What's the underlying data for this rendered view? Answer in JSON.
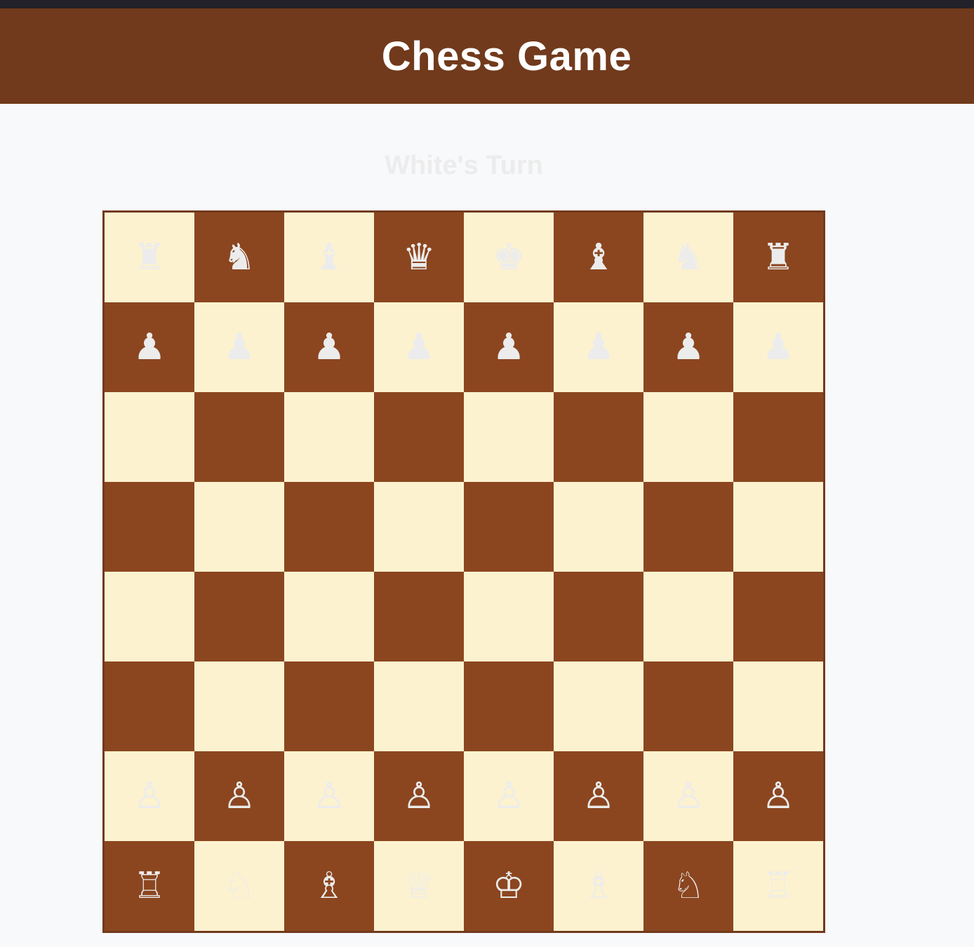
{
  "header": {
    "title": "Chess Game"
  },
  "status": {
    "turn_text": "White's Turn"
  },
  "colors": {
    "header_bg": "#713a1c",
    "light_square": "#fdf2cf",
    "dark_square": "#8b4620",
    "piece": "#ececec"
  },
  "board": {
    "rows": [
      [
        {
          "square": "a8",
          "piece": "♜",
          "piece_name": "black-rook"
        },
        {
          "square": "b8",
          "piece": "♞",
          "piece_name": "black-knight"
        },
        {
          "square": "c8",
          "piece": "♝",
          "piece_name": "black-bishop"
        },
        {
          "square": "d8",
          "piece": "♛",
          "piece_name": "black-queen"
        },
        {
          "square": "e8",
          "piece": "♚",
          "piece_name": "black-king"
        },
        {
          "square": "f8",
          "piece": "♝",
          "piece_name": "black-bishop"
        },
        {
          "square": "g8",
          "piece": "♞",
          "piece_name": "black-knight"
        },
        {
          "square": "h8",
          "piece": "♜",
          "piece_name": "black-rook"
        }
      ],
      [
        {
          "square": "a7",
          "piece": "♟",
          "piece_name": "black-pawn"
        },
        {
          "square": "b7",
          "piece": "♟",
          "piece_name": "black-pawn"
        },
        {
          "square": "c7",
          "piece": "♟",
          "piece_name": "black-pawn"
        },
        {
          "square": "d7",
          "piece": "♟",
          "piece_name": "black-pawn"
        },
        {
          "square": "e7",
          "piece": "♟",
          "piece_name": "black-pawn"
        },
        {
          "square": "f7",
          "piece": "♟",
          "piece_name": "black-pawn"
        },
        {
          "square": "g7",
          "piece": "♟",
          "piece_name": "black-pawn"
        },
        {
          "square": "h7",
          "piece": "♟",
          "piece_name": "black-pawn"
        }
      ],
      [
        {
          "square": "a6",
          "piece": "",
          "piece_name": ""
        },
        {
          "square": "b6",
          "piece": "",
          "piece_name": ""
        },
        {
          "square": "c6",
          "piece": "",
          "piece_name": ""
        },
        {
          "square": "d6",
          "piece": "",
          "piece_name": ""
        },
        {
          "square": "e6",
          "piece": "",
          "piece_name": ""
        },
        {
          "square": "f6",
          "piece": "",
          "piece_name": ""
        },
        {
          "square": "g6",
          "piece": "",
          "piece_name": ""
        },
        {
          "square": "h6",
          "piece": "",
          "piece_name": ""
        }
      ],
      [
        {
          "square": "a5",
          "piece": "",
          "piece_name": ""
        },
        {
          "square": "b5",
          "piece": "",
          "piece_name": ""
        },
        {
          "square": "c5",
          "piece": "",
          "piece_name": ""
        },
        {
          "square": "d5",
          "piece": "",
          "piece_name": ""
        },
        {
          "square": "e5",
          "piece": "",
          "piece_name": ""
        },
        {
          "square": "f5",
          "piece": "",
          "piece_name": ""
        },
        {
          "square": "g5",
          "piece": "",
          "piece_name": ""
        },
        {
          "square": "h5",
          "piece": "",
          "piece_name": ""
        }
      ],
      [
        {
          "square": "a4",
          "piece": "",
          "piece_name": ""
        },
        {
          "square": "b4",
          "piece": "",
          "piece_name": ""
        },
        {
          "square": "c4",
          "piece": "",
          "piece_name": ""
        },
        {
          "square": "d4",
          "piece": "",
          "piece_name": ""
        },
        {
          "square": "e4",
          "piece": "",
          "piece_name": ""
        },
        {
          "square": "f4",
          "piece": "",
          "piece_name": ""
        },
        {
          "square": "g4",
          "piece": "",
          "piece_name": ""
        },
        {
          "square": "h4",
          "piece": "",
          "piece_name": ""
        }
      ],
      [
        {
          "square": "a3",
          "piece": "",
          "piece_name": ""
        },
        {
          "square": "b3",
          "piece": "",
          "piece_name": ""
        },
        {
          "square": "c3",
          "piece": "",
          "piece_name": ""
        },
        {
          "square": "d3",
          "piece": "",
          "piece_name": ""
        },
        {
          "square": "e3",
          "piece": "",
          "piece_name": ""
        },
        {
          "square": "f3",
          "piece": "",
          "piece_name": ""
        },
        {
          "square": "g3",
          "piece": "",
          "piece_name": ""
        },
        {
          "square": "h3",
          "piece": "",
          "piece_name": ""
        }
      ],
      [
        {
          "square": "a2",
          "piece": "♙",
          "piece_name": "white-pawn"
        },
        {
          "square": "b2",
          "piece": "♙",
          "piece_name": "white-pawn"
        },
        {
          "square": "c2",
          "piece": "♙",
          "piece_name": "white-pawn"
        },
        {
          "square": "d2",
          "piece": "♙",
          "piece_name": "white-pawn"
        },
        {
          "square": "e2",
          "piece": "♙",
          "piece_name": "white-pawn"
        },
        {
          "square": "f2",
          "piece": "♙",
          "piece_name": "white-pawn"
        },
        {
          "square": "g2",
          "piece": "♙",
          "piece_name": "white-pawn"
        },
        {
          "square": "h2",
          "piece": "♙",
          "piece_name": "white-pawn"
        }
      ],
      [
        {
          "square": "a1",
          "piece": "♖",
          "piece_name": "white-rook"
        },
        {
          "square": "b1",
          "piece": "♘",
          "piece_name": "white-knight"
        },
        {
          "square": "c1",
          "piece": "♗",
          "piece_name": "white-bishop"
        },
        {
          "square": "d1",
          "piece": "♕",
          "piece_name": "white-queen"
        },
        {
          "square": "e1",
          "piece": "♔",
          "piece_name": "white-king"
        },
        {
          "square": "f1",
          "piece": "♗",
          "piece_name": "white-bishop"
        },
        {
          "square": "g1",
          "piece": "♘",
          "piece_name": "white-knight"
        },
        {
          "square": "h1",
          "piece": "♖",
          "piece_name": "white-rook"
        }
      ]
    ]
  }
}
